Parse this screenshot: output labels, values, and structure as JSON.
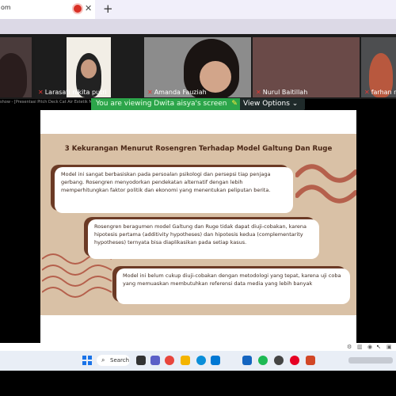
{
  "browser": {
    "tab_title": "om",
    "tab_close": "✕",
    "new_tab": "+"
  },
  "participants": [
    {
      "name": ""
    },
    {
      "name": "Larasati nikita putri"
    },
    {
      "name": "Amanda Fauziah"
    },
    {
      "name": "Nurul Baitillah"
    },
    {
      "name": "farhan n"
    }
  ],
  "share": {
    "doc_title": "show - [Presentasi Pitch Deck Cat Air Estetik Mod",
    "banner_text": "You are viewing Dwita aisya's screen",
    "view_options_label": "View Options ⌄"
  },
  "slide": {
    "title": "3 Kekurangan Menurut Rosengren Terhadap Model Galtung Dan Ruge",
    "points": [
      "Model ini sangat berbasiskan pada persoalan psikologi dan persepsi tiap penjaga gerbang. Rosengren menyodorkan pendekatan alternatif dengan lebih memperhitungkan faktor politik dan ekonomi yang menentukan peliputan berita.",
      "Rosengren beragumen model Galtung dan Ruge tidak dapat diuji-cobakan, karena hipotesis pertama (additivity hypotheses) dan hipotesis kedua (complementarity hypotheses) ternyata bisa diaplikasikan pada setiap kasus.",
      "Model ini belum cukup diuji-cobakan dengan metodologi yang tepat, karena uji coba yang memuaskan membutuhkan referensi data media yang lebih banyak"
    ],
    "colors": {
      "background": "#d9c1a6",
      "accent": "#6b3a25",
      "wave": "#b5604c"
    }
  },
  "taskbar": {
    "search_label": "Search"
  }
}
